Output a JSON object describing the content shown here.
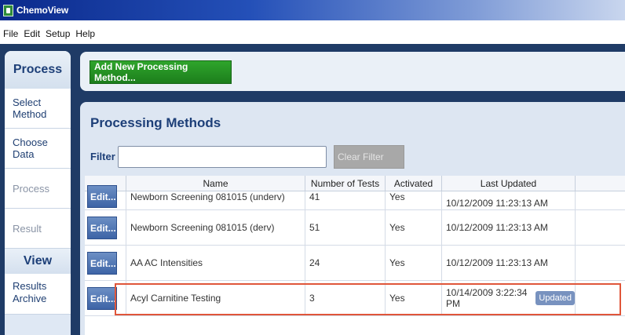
{
  "window": {
    "title": "ChemoView"
  },
  "menu": [
    "File",
    "Edit",
    "Setup",
    "Help"
  ],
  "sidebar": {
    "process_header": "Process",
    "process_items": [
      {
        "label": "Select Method",
        "enabled": true
      },
      {
        "label": "Choose Data",
        "enabled": true
      },
      {
        "label": "Process",
        "enabled": false
      },
      {
        "label": "Result",
        "enabled": false
      }
    ],
    "view_header": "View",
    "view_items": [
      {
        "label": "Results Archive",
        "enabled": true
      }
    ]
  },
  "toolbar": {
    "add_button_label": "Add New Processing Method..."
  },
  "panel": {
    "title": "Processing Methods",
    "filter_label": "Filter",
    "filter_value": "",
    "clear_filter_label": "Clear Filter"
  },
  "table": {
    "columns": [
      "Name",
      "Number of Tests",
      "Activated",
      "Last Updated"
    ],
    "edit_label": "Edit...",
    "rows": [
      {
        "name": "Newborn Screening 081015 (underv)",
        "tests": "41",
        "activated": "Yes",
        "last_updated": "10/12/2009 11:23:13 AM",
        "badge": ""
      },
      {
        "name": "Newborn Screening 081015 (derv)",
        "tests": "51",
        "activated": "Yes",
        "last_updated": "10/12/2009 11:23:13 AM",
        "badge": ""
      },
      {
        "name": "AA AC Intensities",
        "tests": "24",
        "activated": "Yes",
        "last_updated": "10/12/2009 11:23:13 AM",
        "badge": ""
      },
      {
        "name": "Acyl Carnitine Testing",
        "tests": "3",
        "activated": "Yes",
        "last_updated": "10/14/2009 3:22:34 PM",
        "badge": "Updated"
      }
    ]
  },
  "colors": {
    "accent": "#1d3f78",
    "frame": "#1f3b66",
    "green": "#2fa52c",
    "highlight": "#e0563a"
  }
}
